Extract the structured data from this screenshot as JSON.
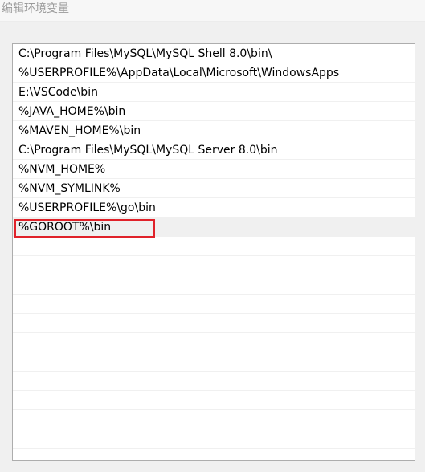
{
  "window": {
    "title": "编辑环境变量"
  },
  "path_list": {
    "items": [
      {
        "label": "C:\\Program Files\\MySQL\\MySQL Shell 8.0\\bin\\",
        "selected": false
      },
      {
        "label": "%USERPROFILE%\\AppData\\Local\\Microsoft\\WindowsApps",
        "selected": false
      },
      {
        "label": "E:\\VSCode\\bin",
        "selected": false
      },
      {
        "label": "%JAVA_HOME%\\bin",
        "selected": false
      },
      {
        "label": "%MAVEN_HOME%\\bin",
        "selected": false
      },
      {
        "label": "C:\\Program Files\\MySQL\\MySQL Server 8.0\\bin",
        "selected": false
      },
      {
        "label": "%NVM_HOME%",
        "selected": false
      },
      {
        "label": "%NVM_SYMLINK%",
        "selected": false
      },
      {
        "label": "%USERPROFILE%\\go\\bin",
        "selected": false
      },
      {
        "label": "%GOROOT%\\bin",
        "selected": true
      }
    ],
    "empty_rows": 12
  },
  "colors": {
    "highlight": "#e0222a",
    "selected_row": "#f0f0f0"
  }
}
